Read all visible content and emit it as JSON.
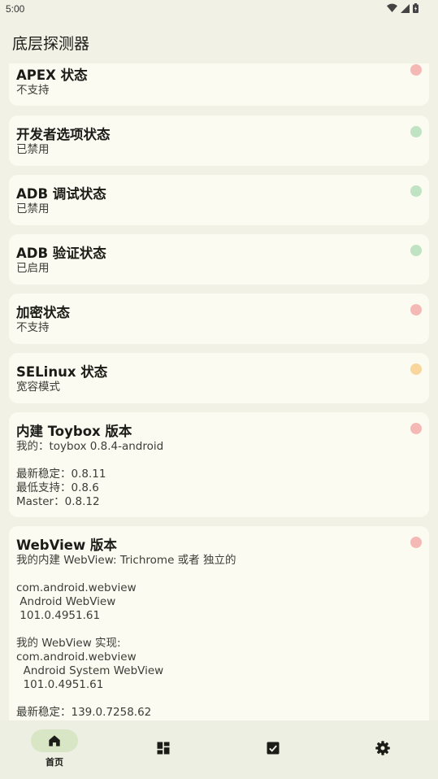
{
  "status_bar": {
    "time": "5:00"
  },
  "app_bar": {
    "title": "底层探测器"
  },
  "cards": [
    {
      "title": "APEX 状态",
      "body": "不支持",
      "status": "red"
    },
    {
      "title": "开发者选项状态",
      "body": "已禁用",
      "status": "green"
    },
    {
      "title": "ADB 调试状态",
      "body": "已禁用",
      "status": "green"
    },
    {
      "title": "ADB 验证状态",
      "body": "已启用",
      "status": "green"
    },
    {
      "title": "加密状态",
      "body": "不支持",
      "status": "red"
    },
    {
      "title": "SELinux 状态",
      "body": "宽容模式",
      "status": "yellow"
    },
    {
      "title": "内建 Toybox 版本",
      "body": "我的：toybox 0.8.4-android\n\n最新稳定：0.8.11\n最低支持：0.8.6\nMaster：0.8.12",
      "status": "red"
    },
    {
      "title": "WebView 版本",
      "body": "我的内建 WebView: Trichrome 或者 独立的\n\ncom.android.webview\n Android WebView\n 101.0.4951.61\n\n我的 WebView 实现:\ncom.android.webview\n  Android System WebView\n  101.0.4951.61\n\n最新稳定：139.0.7258.62",
      "status": "red"
    }
  ],
  "nav": [
    {
      "label": "首页",
      "icon": "home-icon",
      "active": true
    },
    {
      "label": "",
      "icon": "dashboard-icon",
      "active": false
    },
    {
      "label": "",
      "icon": "checkbox-icon",
      "active": false
    },
    {
      "label": "",
      "icon": "gear-icon",
      "active": false
    }
  ],
  "colors": {
    "red": "#f5b9b5",
    "green": "#bfe3c3",
    "yellow": "#f8d69c",
    "nav_active": "#d9e6c5"
  }
}
